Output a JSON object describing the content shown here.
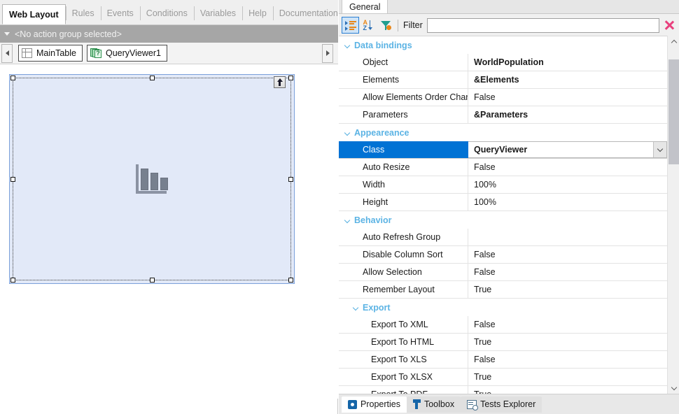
{
  "left": {
    "tabs": [
      {
        "label": "Web Layout",
        "active": true
      },
      {
        "label": "Rules",
        "active": false
      },
      {
        "label": "Events",
        "active": false
      },
      {
        "label": "Conditions",
        "active": false
      },
      {
        "label": "Variables",
        "active": false
      },
      {
        "label": "Help",
        "active": false
      },
      {
        "label": "Documentation",
        "active": false
      }
    ],
    "action_group": {
      "text": "<No action group selected>"
    },
    "element_nav": {
      "prev_arrow": "left-arrow",
      "next_arrow": "right-arrow",
      "items": [
        {
          "label": "MainTable",
          "icon": "table-grid-icon"
        },
        {
          "label": "QueryViewer1",
          "icon": "queryviewer-icon"
        }
      ]
    },
    "canvas": {
      "control_name": "QueryViewer1",
      "placeholder_icon": "bar-chart-icon",
      "up_button_icon": "move-up-arrow-icon",
      "fill_color": "#e2e9f8",
      "border_color": "#7ba0da"
    }
  },
  "right": {
    "panel_tabs": [
      {
        "label": "General",
        "active": true
      }
    ],
    "toolbar": {
      "categorized_icon": "categorized-view-icon",
      "alphabetical_icon": "alphabetical-sort-icon",
      "filter_icon": "filter-funnel-icon",
      "filter_label": "Filter",
      "filter_value": "",
      "filter_placeholder": "",
      "close_icon": "close-x-icon",
      "close_color": "#e8417e"
    },
    "selection_color": "#0072d4",
    "category_color": "#5bb3e4",
    "groups": [
      {
        "name": "Data bindings",
        "level": 1,
        "rows": [
          {
            "name": "Object",
            "value": "WorldPopulation",
            "bold": true,
            "indent": 1
          },
          {
            "name": "Elements",
            "value": "&Elements",
            "bold": true,
            "indent": 1
          },
          {
            "name": "Allow Elements Order Chang",
            "value": "False",
            "bold": false,
            "indent": 1
          },
          {
            "name": "Parameters",
            "value": "&Parameters",
            "bold": true,
            "indent": 1
          }
        ]
      },
      {
        "name": "Appeareance",
        "level": 1,
        "rows": [
          {
            "name": "Class",
            "value": "QueryViewer",
            "bold": true,
            "indent": 1,
            "selected": true,
            "dropdown": true
          },
          {
            "name": "Auto Resize",
            "value": "False",
            "bold": false,
            "indent": 1
          },
          {
            "name": "Width",
            "value": "100%",
            "bold": false,
            "indent": 1
          },
          {
            "name": "Height",
            "value": "100%",
            "bold": false,
            "indent": 1
          }
        ]
      },
      {
        "name": "Behavior",
        "level": 1,
        "rows": [
          {
            "name": "Auto Refresh Group",
            "value": "",
            "bold": false,
            "indent": 1
          },
          {
            "name": "Disable Column Sort",
            "value": "False",
            "bold": false,
            "indent": 1
          },
          {
            "name": "Allow Selection",
            "value": "False",
            "bold": false,
            "indent": 1
          },
          {
            "name": "Remember Layout",
            "value": "True",
            "bold": false,
            "indent": 1
          }
        ]
      },
      {
        "name": "Export",
        "level": 2,
        "rows": [
          {
            "name": "Export To XML",
            "value": "False",
            "bold": false,
            "indent": 2
          },
          {
            "name": "Export To HTML",
            "value": "True",
            "bold": false,
            "indent": 2
          },
          {
            "name": "Export To XLS",
            "value": "False",
            "bold": false,
            "indent": 2
          },
          {
            "name": "Export To XLSX",
            "value": "True",
            "bold": false,
            "indent": 2
          },
          {
            "name": "Export To PDF",
            "value": "True",
            "bold": false,
            "indent": 2
          }
        ]
      }
    ],
    "scrollbar": {
      "up_icon": "scroll-up-icon",
      "down_icon": "scroll-down-icon"
    },
    "dock_tabs": [
      {
        "label": "Properties",
        "icon": "gear-icon",
        "active": true
      },
      {
        "label": "Toolbox",
        "icon": "wrench-icon",
        "active": false
      },
      {
        "label": "Tests Explorer",
        "icon": "tests-explorer-icon",
        "active": false
      }
    ]
  }
}
